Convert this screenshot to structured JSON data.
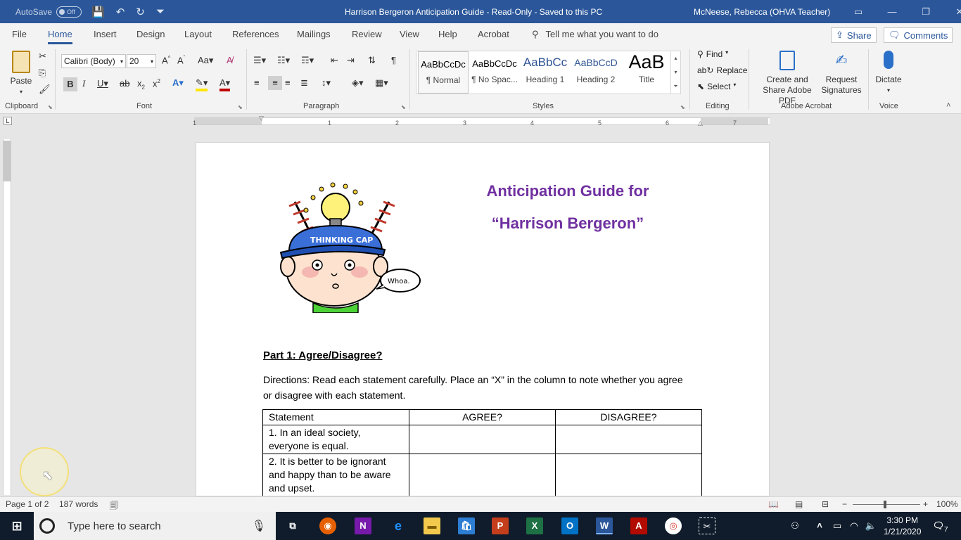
{
  "titlebar": {
    "autosave_label": "AutoSave",
    "autosave_state": "Off",
    "doc_title": "Harrison Bergeron Anticipation Guide  -  Read-Only  -  Saved to this PC",
    "user": "McNeese, Rebecca (OHVA Teacher)"
  },
  "tabs": [
    "File",
    "Home",
    "Insert",
    "Design",
    "Layout",
    "References",
    "Mailings",
    "Review",
    "View",
    "Help",
    "Acrobat"
  ],
  "tell_me": "Tell me what you want to do",
  "share_label": "Share",
  "comments_label": "Comments",
  "ribbon": {
    "clipboard": {
      "label": "Clipboard",
      "paste": "Paste"
    },
    "font": {
      "label": "Font",
      "name": "Calibri (Body)",
      "size": "20"
    },
    "paragraph": {
      "label": "Paragraph"
    },
    "styles": {
      "label": "Styles",
      "items": [
        {
          "preview": "AaBbCcDc",
          "name": "¶ Normal"
        },
        {
          "preview": "AaBbCcDc",
          "name": "¶ No Spac..."
        },
        {
          "preview": "AaBbCc",
          "name": "Heading 1"
        },
        {
          "preview": "AaBbCcD",
          "name": "Heading 2"
        },
        {
          "preview": "AaB",
          "name": "Title"
        }
      ]
    },
    "editing": {
      "label": "Editing",
      "find": "Find",
      "replace": "Replace",
      "select": "Select"
    },
    "acrobat": {
      "label": "Adobe Acrobat",
      "create": "Create and Share Adobe PDF",
      "request": "Request Signatures"
    },
    "voice": {
      "label": "Voice",
      "dictate": "Dictate"
    }
  },
  "ruler_numbers": [
    "1",
    "1",
    "2",
    "3",
    "4",
    "5",
    "6",
    "7"
  ],
  "document": {
    "heading_line1": "Anticipation Guide for",
    "heading_line2": "“Harrison Bergeron”",
    "image_caption": "Whoa.",
    "cap_text": "THINKING CAP",
    "part_title": "Part 1: Agree/Disagree?",
    "directions": "Directions: Read each statement carefully. Place an “X” in the column to note whether you agree or disagree with each statement.",
    "table": {
      "headers": [
        "Statement",
        "AGREE?",
        "DISAGREE?"
      ],
      "rows": [
        "1. In an ideal society, everyone is equal.",
        "2. It is better to be ignorant and happy than to be aware and upset."
      ]
    }
  },
  "statusbar": {
    "page": "Page 1 of 2",
    "words": "187 words",
    "zoom": "100%"
  },
  "taskbar": {
    "search_placeholder": "Type here to search",
    "time": "3:30 PM",
    "date": "1/21/2020",
    "notification_count": "7"
  }
}
